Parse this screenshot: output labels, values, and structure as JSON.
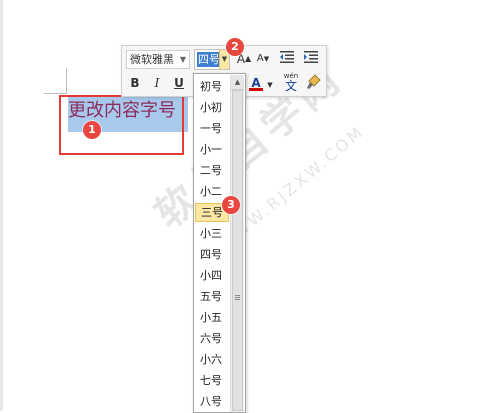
{
  "document": {
    "selected_text": "更改内容字号"
  },
  "toolbar": {
    "font_name": "微软雅黑",
    "font_size": "四号",
    "bold_label": "B",
    "italic_label": "I",
    "underline_label": "U",
    "grow_font_label": "A",
    "shrink_font_label": "A",
    "font_color_label": "A",
    "phonetic_label": "wén",
    "phonetic_char": "文",
    "highlight_color": "#f4d000",
    "font_color": "#d00000"
  },
  "size_list": {
    "items": [
      "初号",
      "小初",
      "一号",
      "小一",
      "二号",
      "小二",
      "三号",
      "小三",
      "四号",
      "小四",
      "五号",
      "小五",
      "六号",
      "小六",
      "七号",
      "八号"
    ],
    "hovered": "三号"
  },
  "markers": [
    "1",
    "2",
    "3"
  ],
  "watermark": {
    "text": "软件自学网",
    "url": "WWW.RJZXW.COM"
  },
  "colors": {
    "selection": "#a8c8ec",
    "text": "#8b2d5a",
    "marker": "#e8473f",
    "highlight_box": "#e53935"
  }
}
